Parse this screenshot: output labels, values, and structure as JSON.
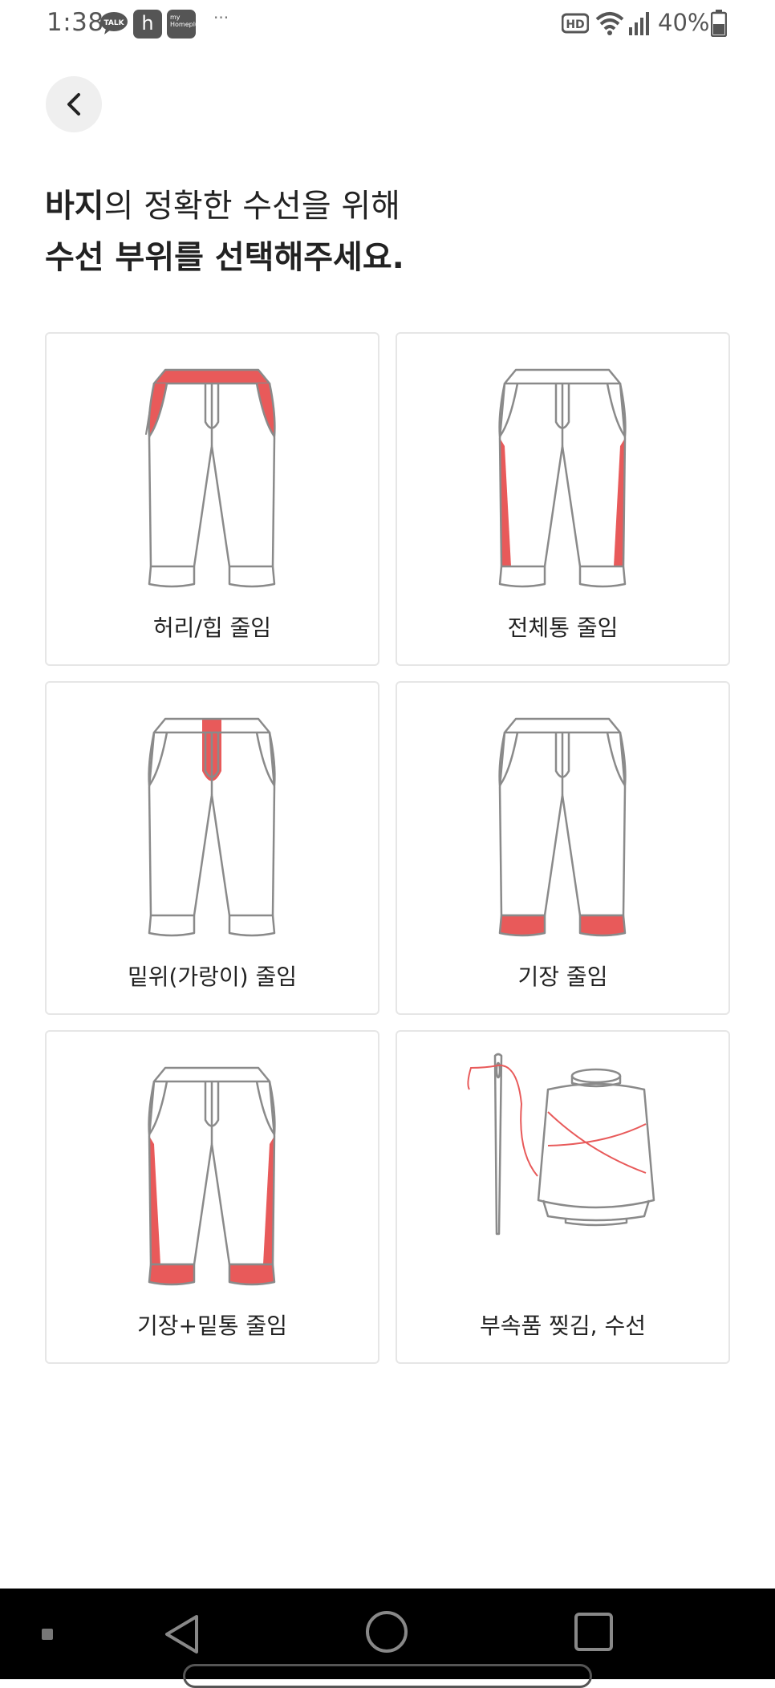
{
  "status_bar": {
    "time": "1:38",
    "talk_icon_text": "TALK",
    "h_icon_text": "h",
    "my_homeplus_text": "my Homeplus",
    "more": "···",
    "battery": "40%"
  },
  "header": {
    "back_icon": "chevron-left-icon"
  },
  "title": {
    "item_bold": "바지",
    "line1_rest": "의 정확한 수선을 위해",
    "line2": "수선 부위를 선택해주세요."
  },
  "colors": {
    "accent": "#e85a5a",
    "outline": "#8a8a8a",
    "card_border": "#e6e6e6"
  },
  "options": [
    {
      "label": "허리/힙 줄임",
      "icon": "pants-waist-hip-icon"
    },
    {
      "label": "전체통 줄임",
      "icon": "pants-full-width-icon"
    },
    {
      "label": "밑위(가랑이) 줄임",
      "icon": "pants-crotch-icon"
    },
    {
      "label": "기장 줄임",
      "icon": "pants-length-icon"
    },
    {
      "label": "기장+밑통 줄임",
      "icon": "pants-length-hem-icon"
    },
    {
      "label": "부속품 찢김, 수선",
      "icon": "needle-thread-icon"
    }
  ]
}
